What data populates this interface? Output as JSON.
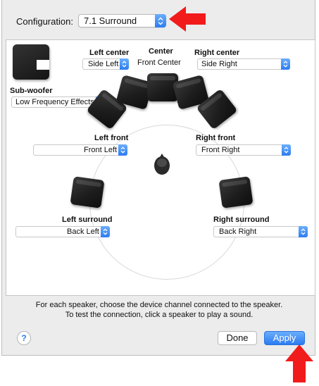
{
  "configuration": {
    "label": "Configuration:",
    "value": "7.1 Surround"
  },
  "speakers": {
    "left_center": {
      "label": "Left center",
      "channel": "Side Left"
    },
    "center": {
      "label": "Center",
      "channel": "Front Center"
    },
    "right_center": {
      "label": "Right center",
      "channel": "Side Right"
    },
    "subwoofer": {
      "label": "Sub-woofer",
      "channel": "Low Frequency Effects"
    },
    "left_front": {
      "label": "Left front",
      "channel": "Front Left"
    },
    "right_front": {
      "label": "Right front",
      "channel": "Front Right"
    },
    "left_surround": {
      "label": "Left surround",
      "channel": "Back Left"
    },
    "right_surround": {
      "label": "Right surround",
      "channel": "Back Right"
    }
  },
  "instructions": {
    "line1": "For each speaker, choose the device channel connected to the speaker.",
    "line2": "To test the connection, click a speaker to play a sound."
  },
  "buttons": {
    "help": "?",
    "done": "Done",
    "apply": "Apply"
  },
  "colors": {
    "accent": "#2d7cf1",
    "annotation_arrow": "#f21b1b"
  },
  "icons": {
    "stepper": "up-down-chevron-icon",
    "annotation": "red-arrow-icon"
  }
}
